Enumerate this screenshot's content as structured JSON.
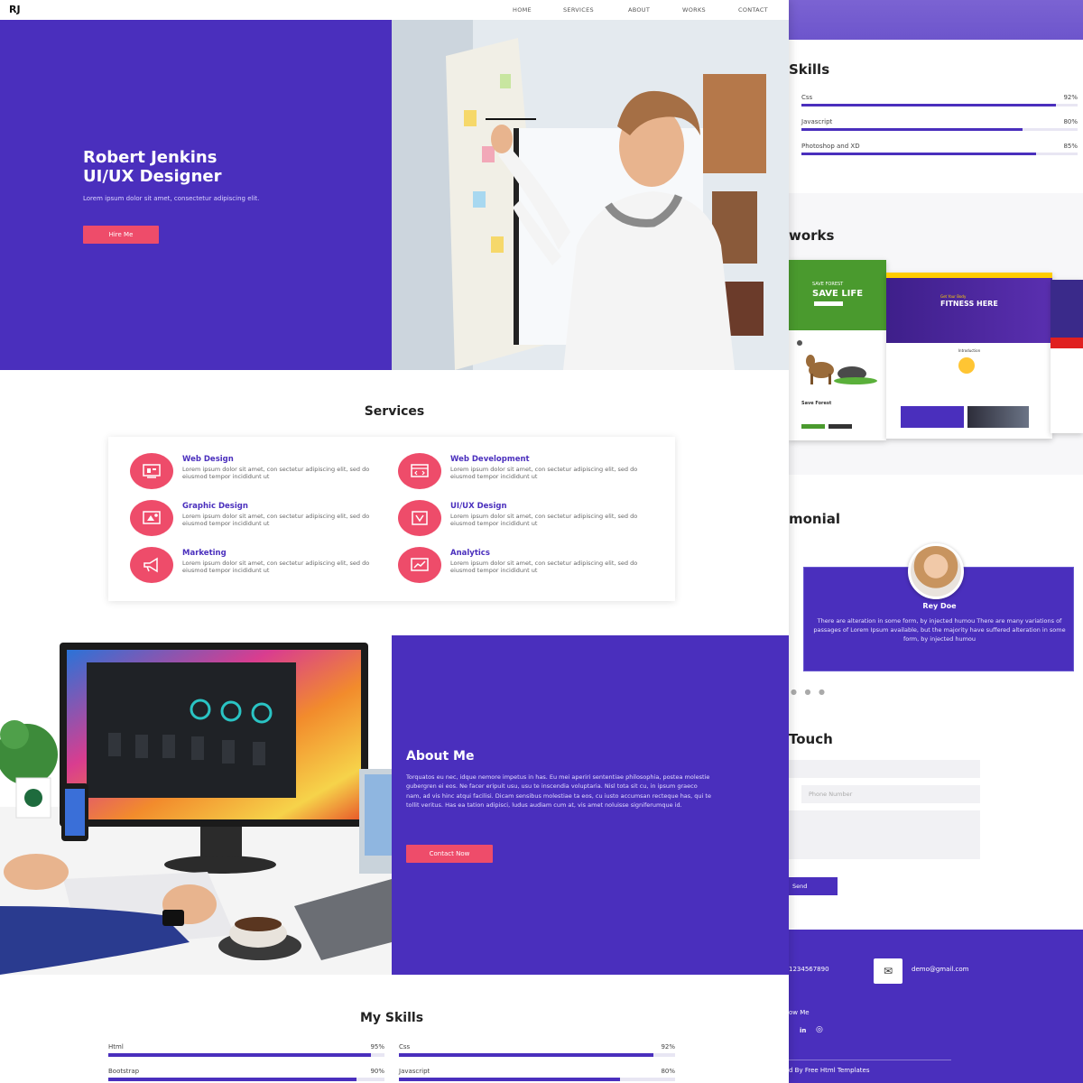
{
  "nav": {
    "logo": "RJ",
    "items": [
      "HOME",
      "SERVICES",
      "ABOUT",
      "WORKS",
      "CONTACT"
    ]
  },
  "hero": {
    "name": "Robert Jenkins",
    "role": "UI/UX Designer",
    "description": "Lorem ipsum dolor sit amet, consectetur adipiscing elit.",
    "button": "Hire Me"
  },
  "services": {
    "title": "Services",
    "items": [
      {
        "name": "Web Design",
        "desc": "Lorem ipsum dolor sit amet, con sectetur adipiscing elit, sed do eiusmod tempor incididunt ut",
        "icon": "web-design-icon"
      },
      {
        "name": "Web Development",
        "desc": "Lorem ipsum dolor sit amet, con sectetur adipiscing elit, sed do eiusmod tempor incididunt ut",
        "icon": "web-development-icon"
      },
      {
        "name": "Graphic Design",
        "desc": "Lorem ipsum dolor sit amet, con sectetur adipiscing elit, sed do eiusmod tempor incididunt ut",
        "icon": "graphic-design-icon"
      },
      {
        "name": "UI/UX Design",
        "desc": "Lorem ipsum dolor sit amet, con sectetur adipiscing elit, sed do eiusmod tempor incididunt ut",
        "icon": "uiux-design-icon"
      },
      {
        "name": "Marketing",
        "desc": "Lorem ipsum dolor sit amet, con sectetur adipiscing elit, sed do eiusmod tempor incididunt ut",
        "icon": "megaphone-icon"
      },
      {
        "name": "Analytics",
        "desc": "Lorem ipsum dolor sit amet, con sectetur adipiscing elit, sed do eiusmod tempor incididunt ut",
        "icon": "analytics-icon"
      }
    ]
  },
  "about": {
    "title": "About Me",
    "text": "Torquatos eu nec, idque nemore impetus in has. Eu mei aperiri sententiae philosophia, postea molestie gubergren ei eos. Ne facer eripuit usu, usu te inscendia voluptaria. Nisl tota sit cu, in ipsum graeco nam, ad vis hinc atqui facilisi. Dicam sensibus molestiae ta eos, cu iusto accumsan recteque has, qui te tollit veritus. Has ea tation adipisci, ludus audiam cum at, vis amet noluisse signiferumque id.",
    "button": "Contact Now"
  },
  "skills": {
    "title": "My Skills",
    "items": [
      {
        "name": "Html",
        "percent_text": "95%",
        "value": 95
      },
      {
        "name": "Css",
        "percent_text": "92%",
        "value": 92
      },
      {
        "name": "Bootstrap",
        "percent_text": "90%",
        "value": 90
      },
      {
        "name": "Javascript",
        "percent_text": "80%",
        "value": 80
      }
    ]
  },
  "preview": {
    "skills_title": "Skills",
    "skills": [
      {
        "name": "Css",
        "percent_text": "92%",
        "value": 92
      },
      {
        "name": "Javascript",
        "percent_text": "80%",
        "value": 80
      },
      {
        "name": "Photoshop and XD",
        "percent_text": "85%",
        "value": 85
      }
    ],
    "works_title": "works",
    "work1_title": "SAVE FOREST",
    "work1_heading": "SAVE LIFE",
    "work1_footer": "Save Forest",
    "work2_heading": "FITNESS HERE",
    "work2_sub": "Get Your Body",
    "work2_section": "Introduction",
    "testimonial_title": "monial",
    "testimonial": {
      "name": "Rey Doe",
      "text": "There are alteration in some form, by injected humou There are many variations of passages of Lorem Ipsum available, but the majority have suffered alteration in some form, by injected humou"
    },
    "touch_title": "Touch",
    "phone_placeholder": "Phone Number",
    "send_label": "Send",
    "phone": "1234567890",
    "email": "demo@gmail.com",
    "follow_label": "ow Me",
    "credit": "d By Free Html Templates"
  },
  "colors": {
    "primary": "#4a2fbd",
    "accent": "#ee4c6a"
  }
}
